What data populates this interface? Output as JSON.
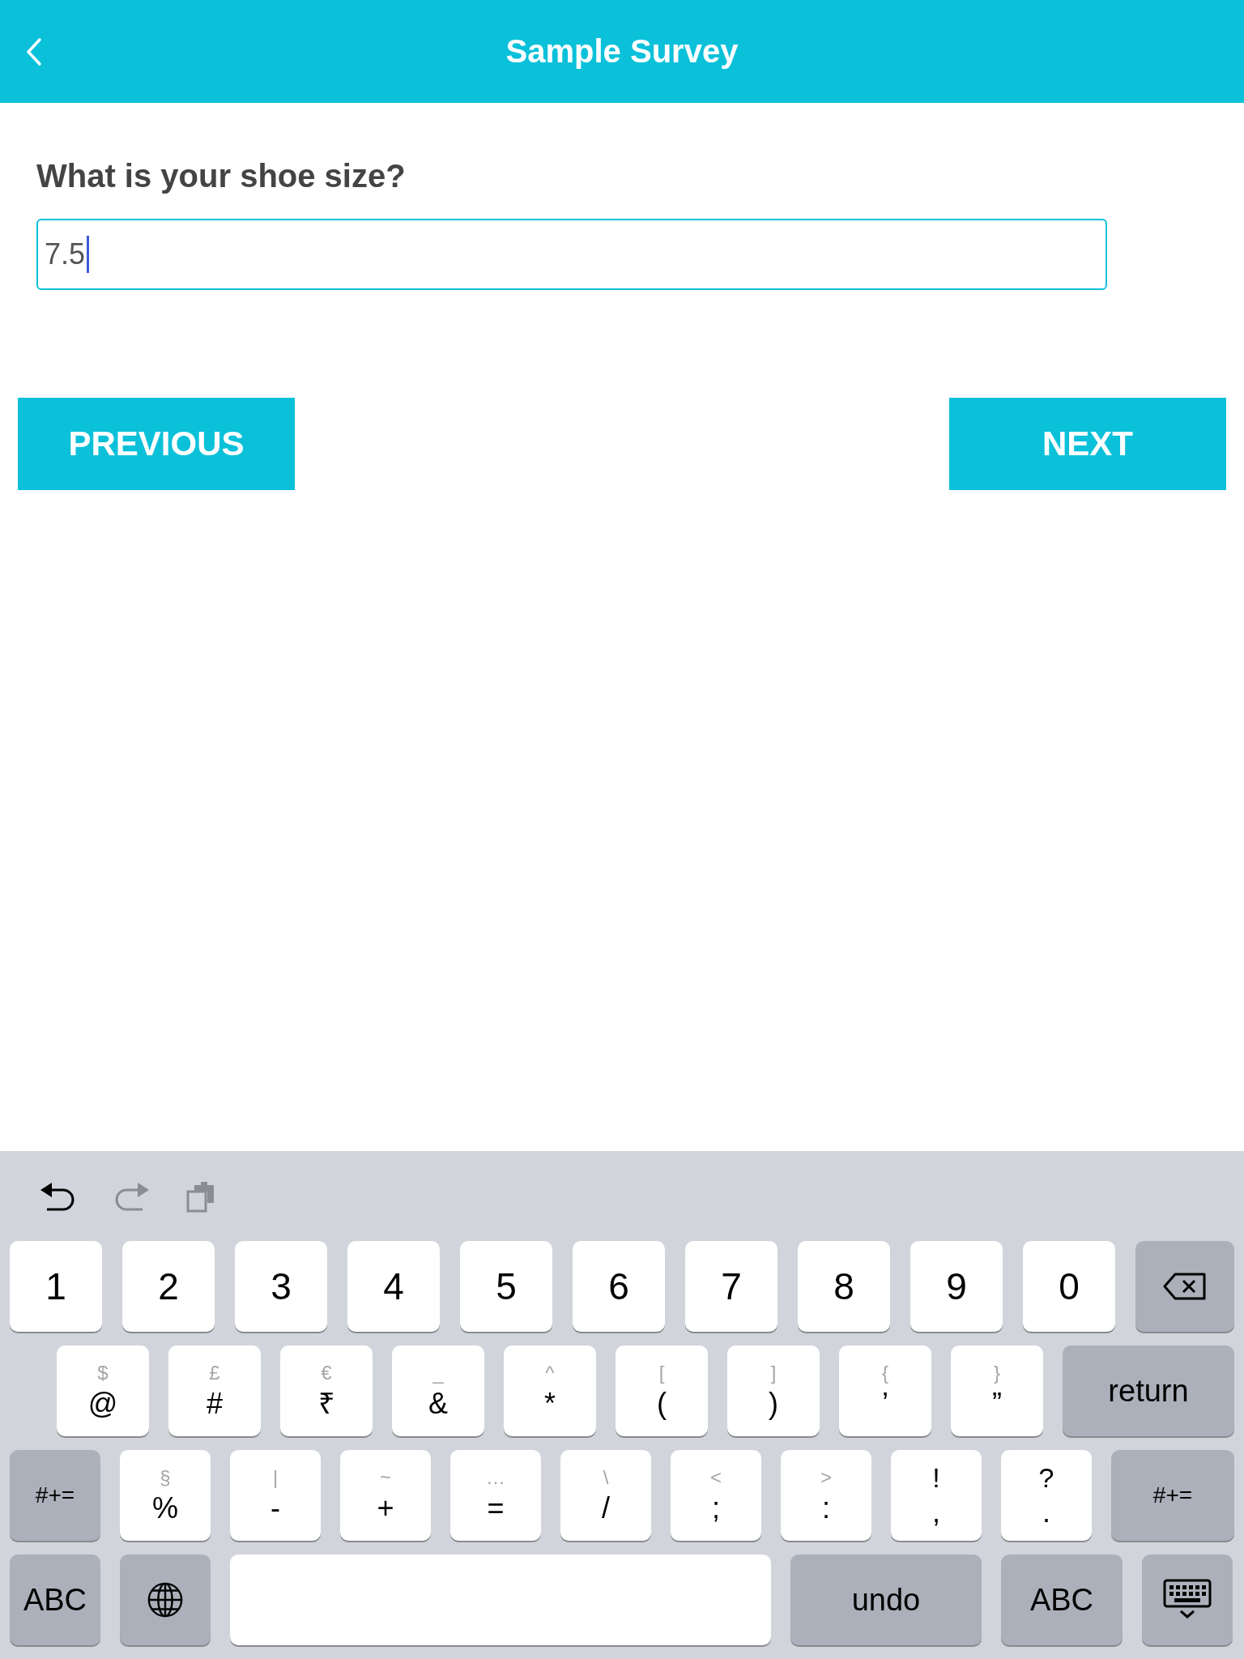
{
  "header": {
    "title": "Sample Survey"
  },
  "question": {
    "label": "What is your shoe size?",
    "value": "7.5"
  },
  "buttons": [
    {
      "label": "PREVIOUS"
    },
    {
      "label": "NEXT"
    }
  ],
  "keyboard": {
    "toolbar": [
      {
        "kind": "undo",
        "disabled": false
      },
      {
        "kind": "redo",
        "disabled": true
      },
      {
        "kind": "paste",
        "disabled": true
      }
    ],
    "rows": [
      {
        "keys": [
          {
            "kind": "char",
            "main": "1"
          },
          {
            "kind": "char",
            "main": "2"
          },
          {
            "kind": "char",
            "main": "3"
          },
          {
            "kind": "char",
            "main": "4"
          },
          {
            "kind": "char",
            "main": "5"
          },
          {
            "kind": "char",
            "main": "6"
          },
          {
            "kind": "char",
            "main": "7"
          },
          {
            "kind": "char",
            "main": "8"
          },
          {
            "kind": "char",
            "main": "9"
          },
          {
            "kind": "char",
            "main": "0"
          },
          {
            "kind": "delete"
          }
        ]
      },
      {
        "keys": [
          {
            "kind": "char",
            "alt": "$",
            "main": "@"
          },
          {
            "kind": "char",
            "alt": "£",
            "main": "#"
          },
          {
            "kind": "char",
            "alt": "€",
            "main": "₹"
          },
          {
            "kind": "char",
            "alt": "_",
            "main": "&"
          },
          {
            "kind": "char",
            "alt": "^",
            "main": "*"
          },
          {
            "kind": "char",
            "alt": "[",
            "main": "("
          },
          {
            "kind": "char",
            "alt": "]",
            "main": ")"
          },
          {
            "kind": "char",
            "alt": "{",
            "main": "’"
          },
          {
            "kind": "char",
            "alt": "}",
            "main": "”"
          },
          {
            "kind": "return",
            "label": "return"
          }
        ]
      },
      {
        "keys": [
          {
            "kind": "mod",
            "label": "#+="
          },
          {
            "kind": "char",
            "alt": "§",
            "main": "%"
          },
          {
            "kind": "char",
            "alt": "|",
            "main": "-"
          },
          {
            "kind": "char",
            "alt": "~",
            "main": "+"
          },
          {
            "kind": "char",
            "alt": "…",
            "main": "="
          },
          {
            "kind": "char",
            "alt": "\\",
            "main": "/"
          },
          {
            "kind": "char",
            "alt": "<",
            "main": ";"
          },
          {
            "kind": "char",
            "alt": ">",
            "main": ":"
          },
          {
            "kind": "dual",
            "alt": "!",
            "main": ","
          },
          {
            "kind": "dual",
            "alt": "?",
            "main": "."
          },
          {
            "kind": "mod",
            "label": "#+="
          }
        ]
      },
      {
        "keys": [
          {
            "kind": "mod",
            "label": "ABC"
          },
          {
            "kind": "globe"
          },
          {
            "kind": "space"
          },
          {
            "kind": "mod",
            "label": "undo"
          },
          {
            "kind": "mod",
            "label": "ABC"
          },
          {
            "kind": "hide"
          }
        ]
      }
    ]
  }
}
